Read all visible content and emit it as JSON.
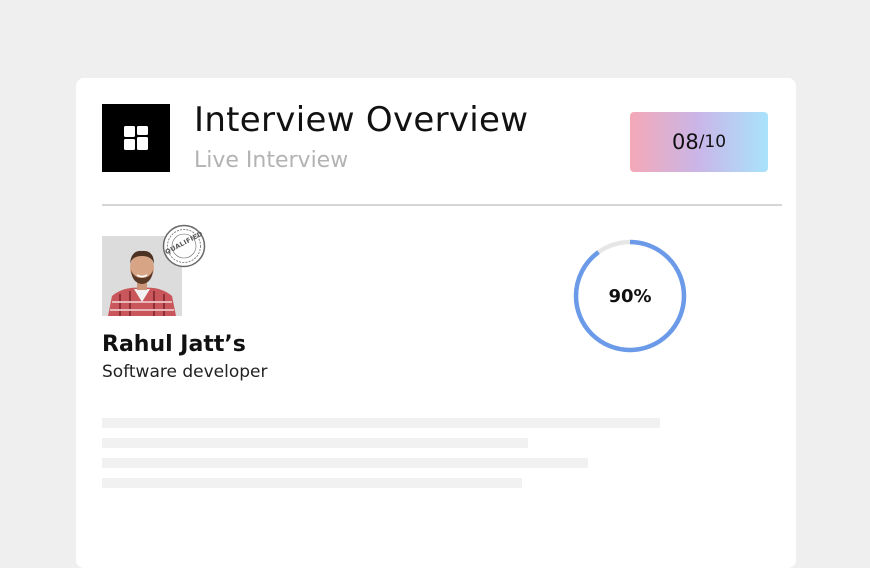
{
  "header": {
    "title": "Interview Overview",
    "subtitle": "Live Interview",
    "score": "08",
    "score_total": "/10",
    "score_gradient": [
      "#f4a8b7",
      "#a9e3fb"
    ],
    "logo_icon": "dashboard-grid-icon"
  },
  "candidate": {
    "name": "Rahul Jatt’s",
    "role": "Software developer",
    "stamp_text": "QUALIFIED",
    "stamp_icon": "qualified-stamp-icon"
  },
  "progress": {
    "label": "90%",
    "value": 0.9,
    "color": "#6b9be8",
    "track_color": "#e6e6e6"
  },
  "colors": {
    "background": "#efefef",
    "card": "#ffffff",
    "divider": "#d6d6d6",
    "skeleton": "#f1f1f1"
  }
}
